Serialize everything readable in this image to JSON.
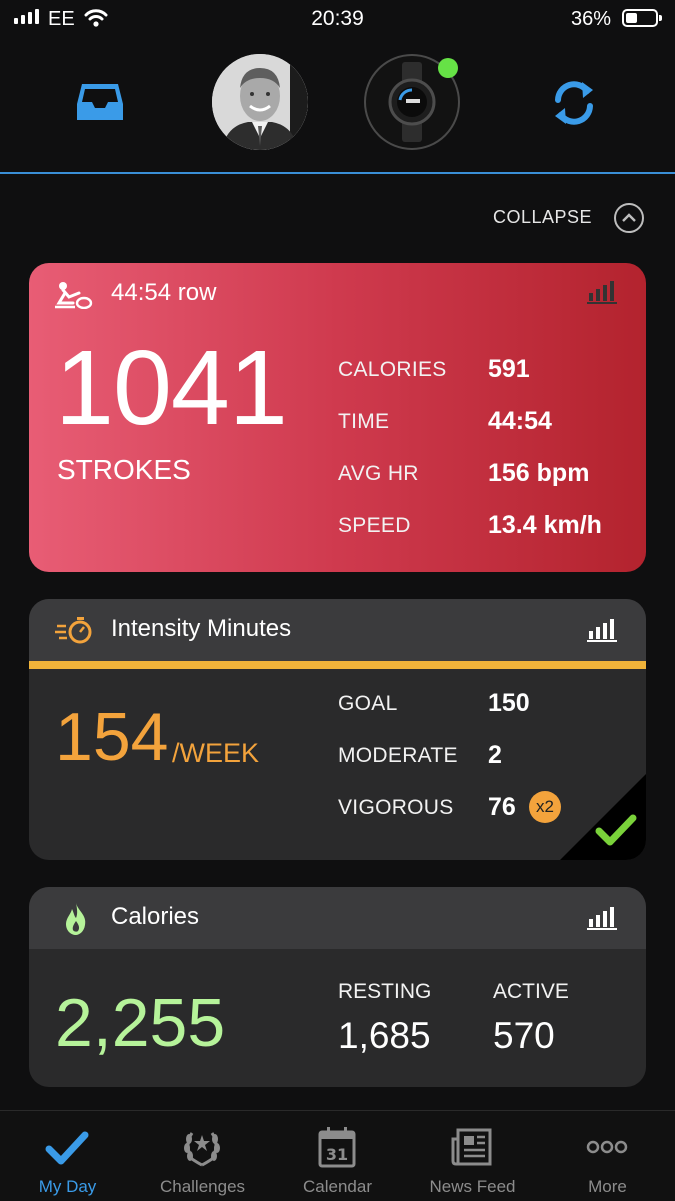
{
  "status_bar": {
    "carrier": "EE",
    "time": "20:39",
    "battery": "36%"
  },
  "header": {
    "icons": [
      "inbox-icon",
      "avatar",
      "device-watch",
      "sync-icon"
    ]
  },
  "collapse_label": "COLLAPSE",
  "activity": {
    "title": "44:54 row",
    "big_value": "1041",
    "big_label": "STROKES",
    "stats": [
      {
        "label": "CALORIES",
        "value": "591"
      },
      {
        "label": "TIME",
        "value": "44:54"
      },
      {
        "label": "AVG HR",
        "value": "156 bpm"
      },
      {
        "label": "SPEED",
        "value": "13.4 km/h"
      }
    ],
    "color": "#d9394d"
  },
  "intensity": {
    "title": "Intensity Minutes",
    "big_value": "154",
    "big_unit": "/WEEK",
    "stats": [
      {
        "label": "GOAL",
        "value": "150"
      },
      {
        "label": "MODERATE",
        "value": "2"
      },
      {
        "label": "VIGOROUS",
        "value": "76"
      }
    ],
    "multiplier": "x2",
    "accent": "#f3a33c",
    "goal_met": true
  },
  "calories": {
    "title": "Calories",
    "big_value": "2,255",
    "resting_label": "RESTING",
    "resting_value": "1,685",
    "active_label": "ACTIVE",
    "active_value": "570",
    "accent": "#b6f39a"
  },
  "tabs": [
    {
      "label": "My Day",
      "icon": "checkmark-icon",
      "active": true
    },
    {
      "label": "Challenges",
      "icon": "laurel-icon",
      "active": false
    },
    {
      "label": "Calendar",
      "icon": "calendar-icon",
      "calendar_day": "31",
      "active": false
    },
    {
      "label": "News Feed",
      "icon": "newspaper-icon",
      "active": false
    },
    {
      "label": "More",
      "icon": "more-icon",
      "active": false
    }
  ]
}
